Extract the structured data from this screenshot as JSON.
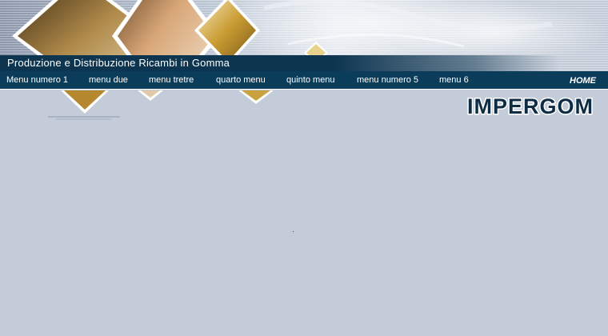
{
  "header": {
    "tagline": "Produzione e Distribuzione Ricambi in Gomma",
    "home_label": "HOME",
    "brand_logo_text": "IMPERGOM"
  },
  "nav": {
    "items": [
      {
        "label": "Menu numero 1"
      },
      {
        "label": "menu due"
      },
      {
        "label": "menu tretre"
      },
      {
        "label": "quarto menu"
      },
      {
        "label": "quinto menu"
      },
      {
        "label": "menu numero 5"
      },
      {
        "label": "menu 6"
      }
    ]
  },
  "colors": {
    "page_background": "#c3ccd8",
    "nav_bar": "#0b3c5a",
    "tagline_bar": "#0d3550",
    "text": "#ffffff",
    "gold_accent": "#c9a13f"
  },
  "icons": {
    "home": "home-text-icon",
    "logo": "impergom-logo"
  }
}
